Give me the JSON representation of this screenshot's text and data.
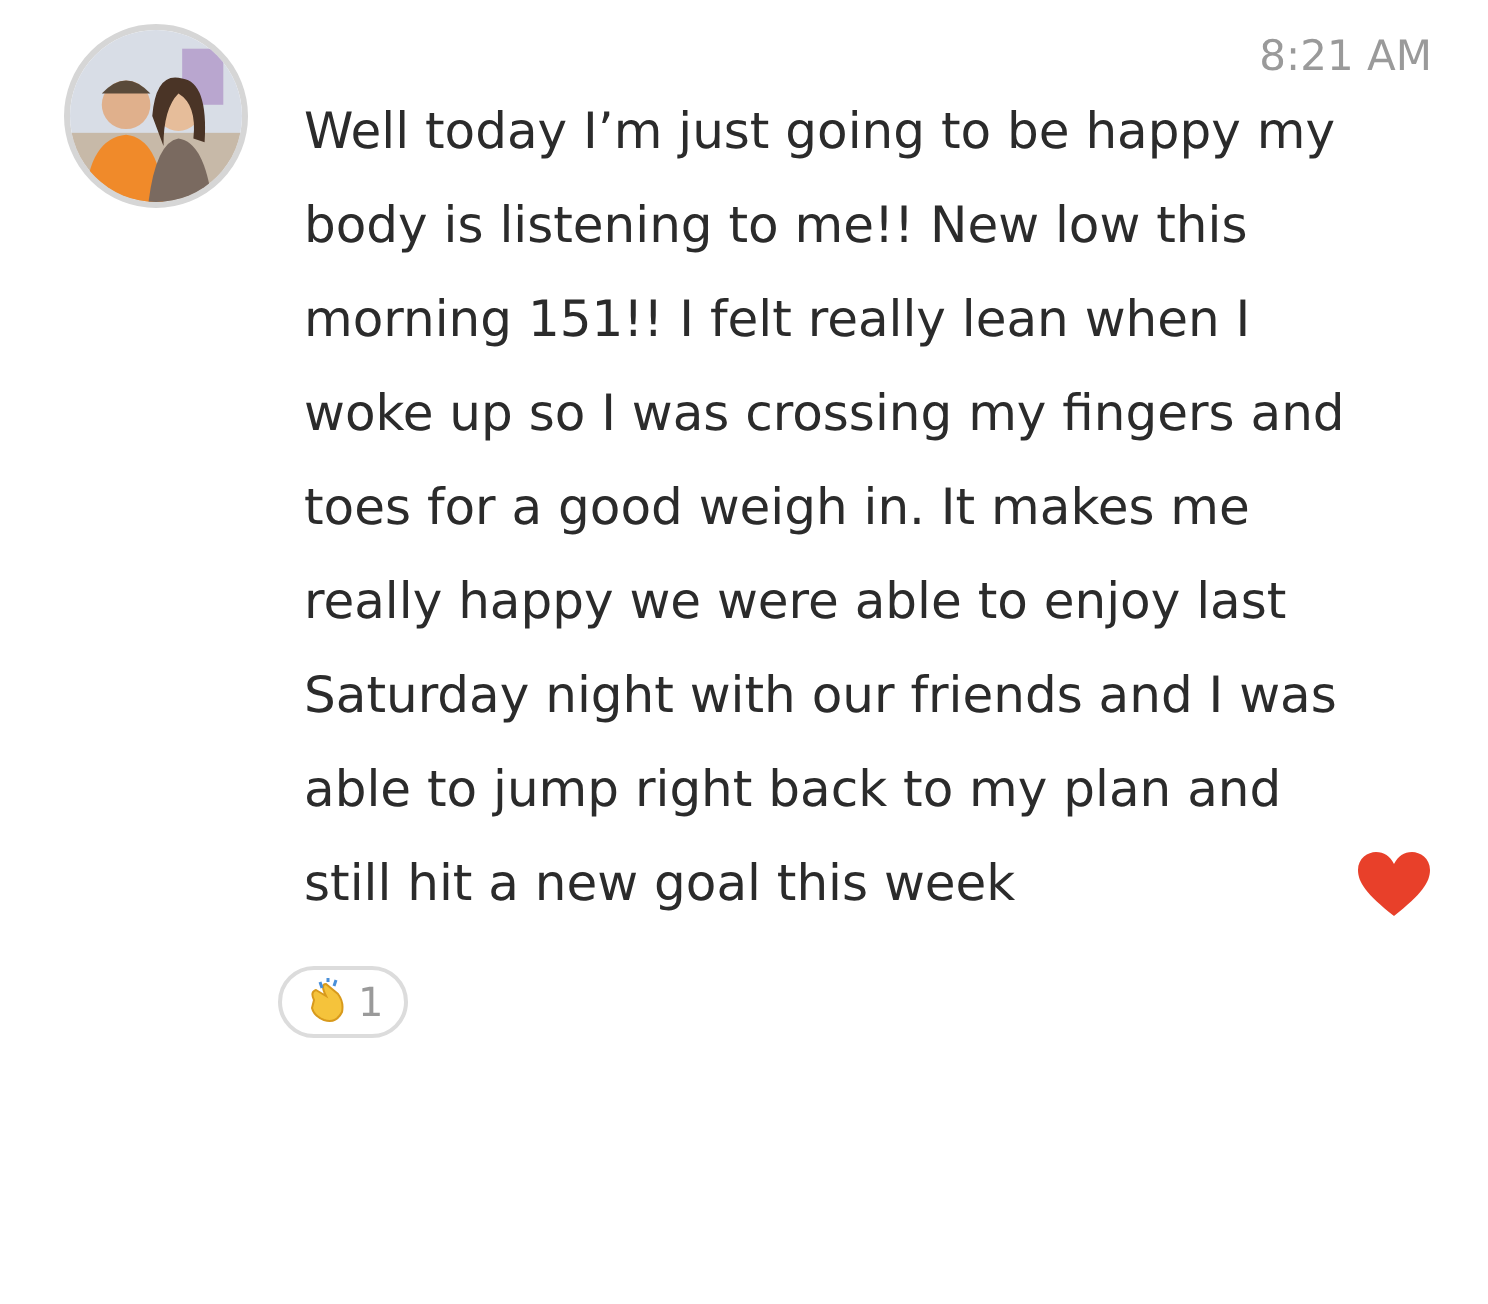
{
  "post": {
    "time": "8:21 AM",
    "text": "Well today I’m just going to be happy my body is listening to me!! New low this morning 151!! I felt really lean when I woke up so I was crossing my fingers and toes for a good weigh in. It makes me really happy we were able to enjoy last Saturday night with our friends and I was able to jump right back to my plan and still hit a new goal this week",
    "reactions": [
      {
        "kind": "clap",
        "count": "1"
      }
    ]
  }
}
